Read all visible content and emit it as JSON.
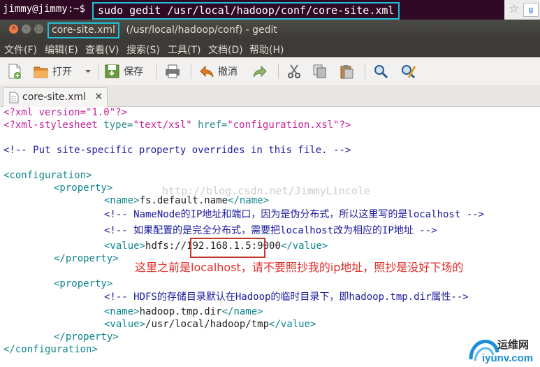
{
  "terminal": {
    "prompt": "jimmy@jimmy:~$",
    "command": "sudo gedit /usr/local/hadoop/conf/core-site.xml"
  },
  "window": {
    "title_file": "core-site.xml",
    "title_rest": " (/usr/local/hadoop/conf) - gedit"
  },
  "menu": [
    "文件(F)",
    "编辑(E)",
    "查看(V)",
    "搜索(S)",
    "工具(T)",
    "文档(D)",
    "帮助(H)"
  ],
  "toolbar": {
    "open_label": "打开",
    "save_label": "保存",
    "undo_label": "撤消"
  },
  "tab": {
    "label": "core-site.xml",
    "close": "✕"
  },
  "code": {
    "l1_a": "<?xml version=",
    "l1_b": "\"1.0\"",
    "l1_c": "?>",
    "l2_a": "<?xml-stylesheet ",
    "l2_b": "type=",
    "l2_c": "\"text/xsl\"",
    "l2_d": " href=",
    "l2_e": "\"configuration.xsl\"",
    "l2_f": "?>",
    "l4": "<!-- Put site-specific property overrides in this file. -->",
    "l6": "<configuration>",
    "l7": "<property>",
    "l8_open": "<name>",
    "l8_text": "fs.default.name",
    "l8_close": "</name>",
    "l9": "<!-- NameNode的IP地址和端口，因为是伪分布式，所以这里写的是localhost -->",
    "l10": "<!-- 如果配置的是完全分布式，需要把localhost改为相应的IP地址 -->",
    "l11_open": "<value>",
    "l11_text": "hdfs://192.168.1.5:9000",
    "l11_close": "</value>",
    "l12": "</property>",
    "l13": "<property>",
    "l14": "<!-- HDFS的存储目录默认在Hadoop的临时目录下，即hadoop.tmp.dir属性-->",
    "l15_open": "<name>",
    "l15_text": "hadoop.tmp.dir",
    "l15_close": "</name>",
    "l16_open": "<value>",
    "l16_text": "/usr/local/hadoop/tmp",
    "l16_close": "</value>",
    "l17": "</property>",
    "l18": "</configuration>"
  },
  "watermark": "http://blog.csdn.net/JimmyLincole",
  "annotation": "这里之前是localhost，请不要照抄我的ip地址，照抄是没好下场的",
  "logo": {
    "text_cn": "运维网",
    "text_en": "iyunv.com"
  }
}
